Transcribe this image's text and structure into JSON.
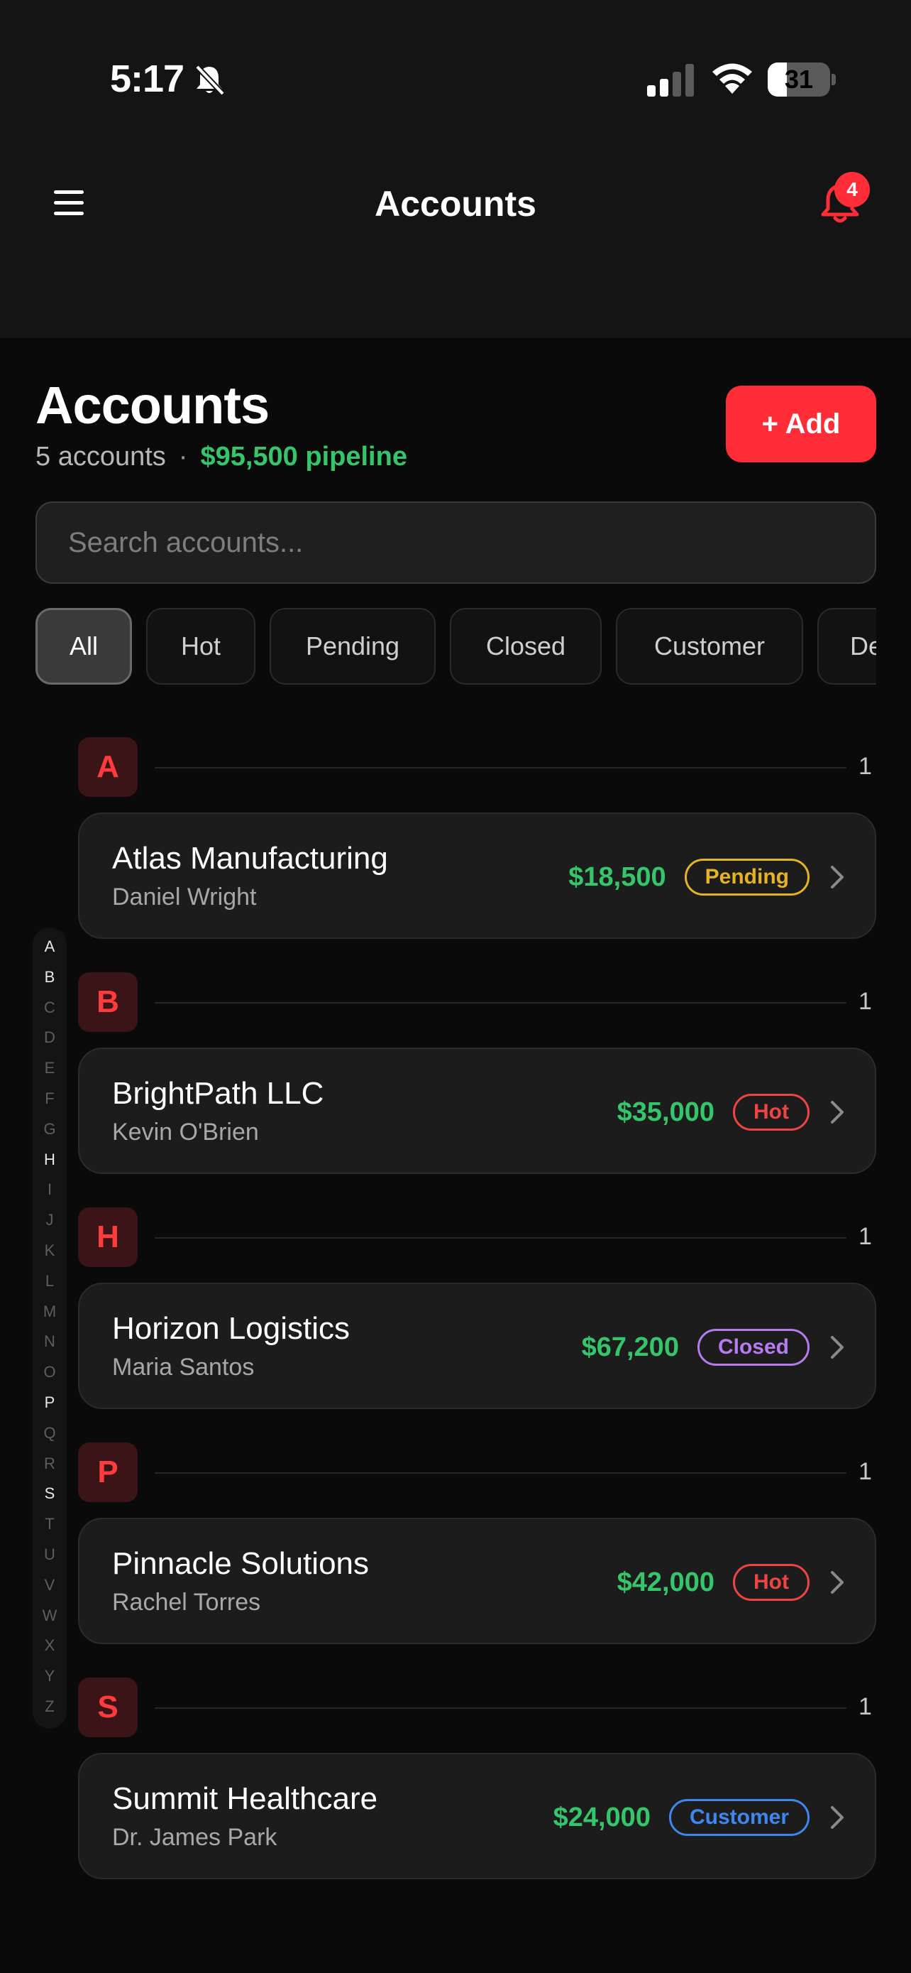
{
  "status_bar": {
    "time": "5:17",
    "battery": "31",
    "battery_level": 0.31
  },
  "header": {
    "title": "Accounts",
    "notification_count": "4"
  },
  "page": {
    "title": "Accounts",
    "count_text": "5 accounts",
    "separator": "·",
    "pipeline_text": "$95,500 pipeline",
    "add_label": "+ Add"
  },
  "search": {
    "placeholder": "Search accounts..."
  },
  "filters": [
    "All",
    "Hot",
    "Pending",
    "Closed",
    "Customer",
    "De"
  ],
  "alphabet": [
    "A",
    "B",
    "C",
    "D",
    "E",
    "F",
    "G",
    "H",
    "I",
    "J",
    "K",
    "L",
    "M",
    "N",
    "O",
    "P",
    "Q",
    "R",
    "S",
    "T",
    "U",
    "V",
    "W",
    "X",
    "Y",
    "Z"
  ],
  "alphabet_active": [
    "A",
    "B",
    "H",
    "P",
    "S"
  ],
  "sections": [
    {
      "letter": "A",
      "count": "1",
      "account": {
        "name": "Atlas Manufacturing",
        "contact": "Daniel Wright",
        "amount": "$18,500",
        "status": "Pending",
        "color": "#e6b422"
      }
    },
    {
      "letter": "B",
      "count": "1",
      "account": {
        "name": "BrightPath LLC",
        "contact": "Kevin O'Brien",
        "amount": "$35,000",
        "status": "Hot",
        "color": "#f04444"
      }
    },
    {
      "letter": "H",
      "count": "1",
      "account": {
        "name": "Horizon Logistics",
        "contact": "Maria Santos",
        "amount": "$67,200",
        "status": "Closed",
        "color": "#b57cf0"
      }
    },
    {
      "letter": "P",
      "count": "1",
      "account": {
        "name": "Pinnacle Solutions",
        "contact": "Rachel Torres",
        "amount": "$42,000",
        "status": "Hot",
        "color": "#f04444"
      }
    },
    {
      "letter": "S",
      "count": "1",
      "account": {
        "name": "Summit Healthcare",
        "contact": "Dr. James Park",
        "amount": "$24,000",
        "status": "Customer",
        "color": "#3f86ee"
      }
    }
  ],
  "colors": {
    "accent": "#ff2d37",
    "money": "#35c56a",
    "background": "#0a0a0a",
    "card": "#1c1c1c"
  }
}
